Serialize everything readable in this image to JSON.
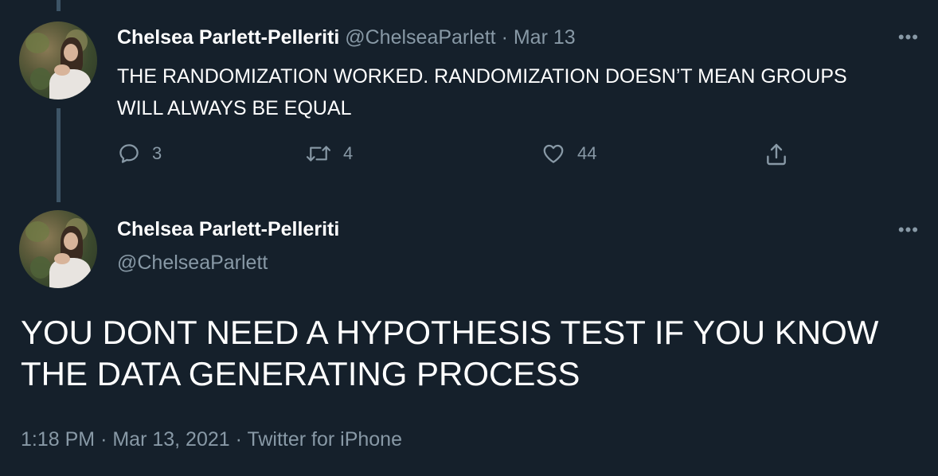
{
  "thread": [
    {
      "author": {
        "name": "Chelsea Parlett-Pelleriti",
        "handle": "@ChelseaParlett",
        "separator": "·",
        "date": "Mar 13"
      },
      "text": "THE RANDOMIZATION WORKED. RANDOMIZATION DOESN’T MEAN GROUPS WILL ALWAYS BE EQUAL",
      "more_label": "•••",
      "actions": {
        "reply_count": "3",
        "retweet_count": "4",
        "like_count": "44"
      }
    }
  ],
  "main_tweet": {
    "author": {
      "name": "Chelsea Parlett-Pelleriti",
      "handle": "@ChelseaParlett"
    },
    "more_label": "•••",
    "text": "YOU DONT NEED A HYPOTHESIS TEST IF YOU KNOW THE DATA GENERATING PROCESS",
    "time": "1:18 PM",
    "sep1": "·",
    "date": "Mar 13, 2021",
    "sep2": "·",
    "source": "Twitter for iPhone"
  },
  "colors": {
    "background": "#15202b",
    "muted": "#8899a6",
    "thread_line": "#3d5466"
  },
  "icons": [
    "reply-icon",
    "retweet-icon",
    "like-icon",
    "share-icon",
    "more-icon"
  ]
}
